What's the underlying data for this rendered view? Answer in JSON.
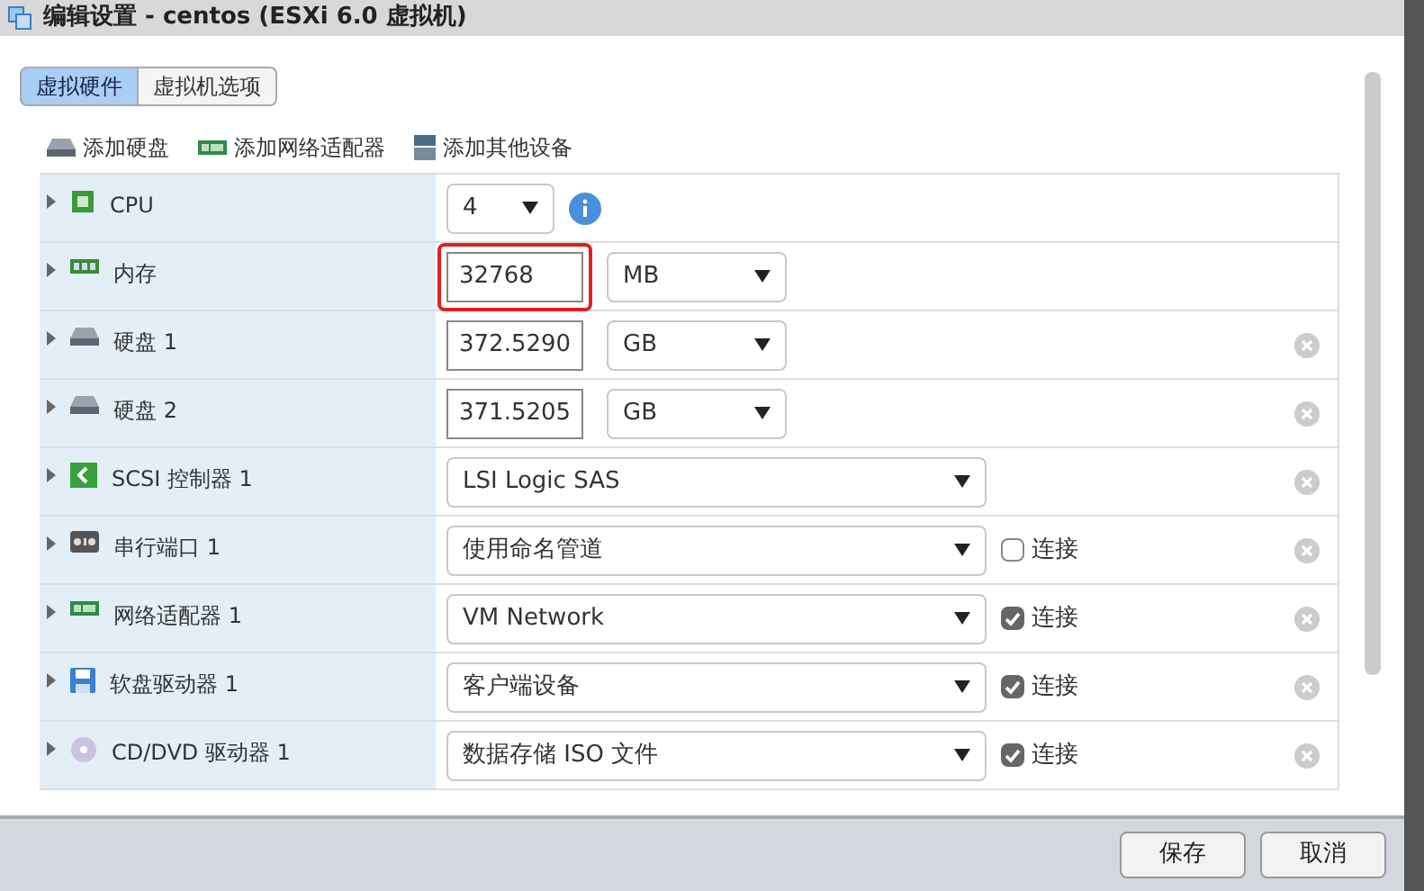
{
  "window": {
    "title": "编辑设置 - centos (ESXi 6.0 虚拟机)"
  },
  "tabs": [
    {
      "label": "虚拟硬件",
      "selected": true
    },
    {
      "label": "虚拟机选项",
      "selected": false
    }
  ],
  "toolbar": [
    {
      "label": "添加硬盘"
    },
    {
      "label": "添加网络适配器"
    },
    {
      "label": "添加其他设备"
    }
  ],
  "devices": [
    {
      "name": "CPU",
      "kind": "select_info",
      "value": "4",
      "removable": false
    },
    {
      "name": "内存",
      "kind": "size",
      "value": "32768",
      "unit": "MB",
      "highlighted": true,
      "removable": false
    },
    {
      "name": "硬盘 1",
      "kind": "size",
      "value": "372.5290",
      "unit": "GB",
      "highlighted": false,
      "removable": true
    },
    {
      "name": "硬盘 2",
      "kind": "size",
      "value": "371.5205",
      "unit": "GB",
      "highlighted": false,
      "removable": true
    },
    {
      "name": "SCSI 控制器 1",
      "kind": "select",
      "value": "LSI Logic SAS",
      "removable": true
    },
    {
      "name": "串行端口 1",
      "kind": "select_connect",
      "value": "使用命名管道",
      "connect_label": "连接",
      "connected": false,
      "removable": true
    },
    {
      "name": "网络适配器 1",
      "kind": "select_connect",
      "value": "VM Network",
      "connect_label": "连接",
      "connected": true,
      "removable": true
    },
    {
      "name": "软盘驱动器 1",
      "kind": "select_connect",
      "value": "客户端设备",
      "connect_label": "连接",
      "connected": true,
      "removable": true
    },
    {
      "name": "CD/DVD 驱动器 1",
      "kind": "select_connect",
      "value": "数据存储 ISO 文件",
      "connect_label": "连接",
      "connected": true,
      "removable": true
    }
  ],
  "buttons": [
    "保存",
    "取消"
  ]
}
